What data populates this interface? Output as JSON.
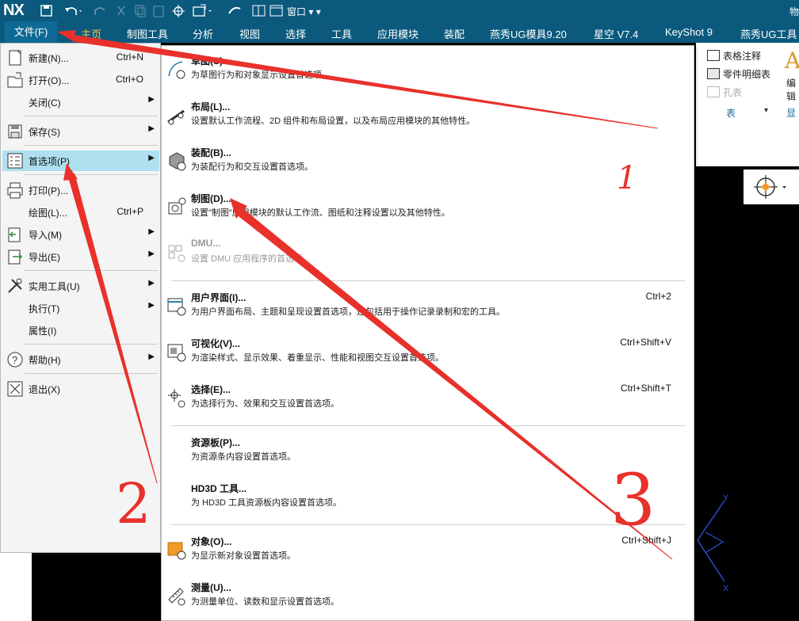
{
  "app": {
    "logo": "NX",
    "window_menu": "窗口",
    "title_right": "物"
  },
  "ribbon_tabs": [
    {
      "label": "主页",
      "active": true
    },
    {
      "label": "制图工具"
    },
    {
      "label": "分析"
    },
    {
      "label": "视图"
    },
    {
      "label": "选择"
    },
    {
      "label": "工具"
    },
    {
      "label": "应用模块"
    },
    {
      "label": "装配"
    },
    {
      "label": "燕秀UG模具9.20"
    },
    {
      "label": "星空 V7.4"
    },
    {
      "label": "KeyShot 9"
    },
    {
      "label": "燕秀UG工具"
    }
  ],
  "file_tab": {
    "label": "文件(F)"
  },
  "ribbon_right": {
    "table_note": "表格注释",
    "parts_list": "零件明细表",
    "hole_table": "孔表",
    "group_label": "表",
    "big_button": "编辑",
    "big_glyph": "A",
    "show_label": "显示"
  },
  "file_menu": {
    "items": [
      {
        "label": "新建(N)...",
        "shortcut": "Ctrl+N",
        "icon": "new-icon"
      },
      {
        "label": "打开(O)...",
        "shortcut": "Ctrl+O",
        "icon": "open-icon"
      },
      {
        "label": "关闭(C)",
        "submenu": true
      },
      {
        "label": "保存(S)",
        "submenu": true,
        "icon": "save-icon"
      },
      {
        "label": "首选项(P)",
        "submenu": true,
        "highlighted": true,
        "icon": "preferences-icon"
      },
      {
        "label": "打印(P)...",
        "icon": "print-icon"
      },
      {
        "label": "绘图(L)...",
        "shortcut": "Ctrl+P"
      },
      {
        "label": "导入(M)",
        "submenu": true,
        "icon": "import-icon"
      },
      {
        "label": "导出(E)",
        "submenu": true,
        "icon": "export-icon"
      },
      {
        "label": "实用工具(U)",
        "submenu": true,
        "icon": "utilities-icon"
      },
      {
        "label": "执行(T)",
        "submenu": true
      },
      {
        "label": "属性(I)"
      },
      {
        "label": "帮助(H)",
        "submenu": true,
        "icon": "help-icon"
      },
      {
        "label": "退出(X)",
        "icon": "exit-icon"
      }
    ]
  },
  "preferences_menu": {
    "items": [
      {
        "title": "草图(S)...",
        "desc": "为草图行为和对象显示设置首选项。",
        "icon": "sketch-prefs-icon"
      },
      {
        "title": "布局(L)...",
        "desc": "设置默认工作流程、2D 组件和布局设置，以及布局应用模块的其他特性。",
        "icon": "layout-prefs-icon"
      },
      {
        "title": "装配(B)...",
        "desc": "为装配行为和交互设置首选项。",
        "icon": "assembly-prefs-icon"
      },
      {
        "title": "制图(D)...",
        "desc": "设置\"制图\"应用模块的默认工作流、图纸和注释设置以及其他特性。",
        "icon": "drafting-prefs-icon"
      },
      {
        "title": "DMU...",
        "desc": "设置 DMU 应用程序的首选项。",
        "disabled": true,
        "icon": "dmu-prefs-icon"
      },
      {
        "title": "用户界面(I)...",
        "shortcut": "Ctrl+2",
        "desc": "为用户界面布局、主题和呈现设置首选项，还包括用于操作记录录制和宏的工具。",
        "icon": "ui-prefs-icon"
      },
      {
        "title": "可视化(V)...",
        "shortcut": "Ctrl+Shift+V",
        "desc": "为渲染样式、显示效果、着重显示、性能和视图交互设置首选项。",
        "icon": "visualization-prefs-icon"
      },
      {
        "title": "选择(E)...",
        "shortcut": "Ctrl+Shift+T",
        "desc": "为选择行为、效果和交互设置首选项。",
        "icon": "selection-prefs-icon"
      },
      {
        "title": "资源板(P)...",
        "desc": "为资源条内容设置首选项。"
      },
      {
        "title": "HD3D 工具...",
        "desc": "为 HD3D 工具资源板内容设置首选项。"
      },
      {
        "title": "对象(O)...",
        "shortcut": "Ctrl+Shift+J",
        "desc": "为显示新对象设置首选项。",
        "icon": "object-prefs-icon"
      },
      {
        "title": "测量(U)...",
        "desc": "为测量单位、读数和显示设置首选项。",
        "icon": "measure-prefs-icon"
      }
    ]
  },
  "annotations": {
    "one": "1",
    "two": "2",
    "three": "3"
  },
  "colors": {
    "accent_bar": "#0b5a7e",
    "highlight": "#aee0f0",
    "annotation": "#e8312b",
    "active_tab": "#f7c542"
  }
}
